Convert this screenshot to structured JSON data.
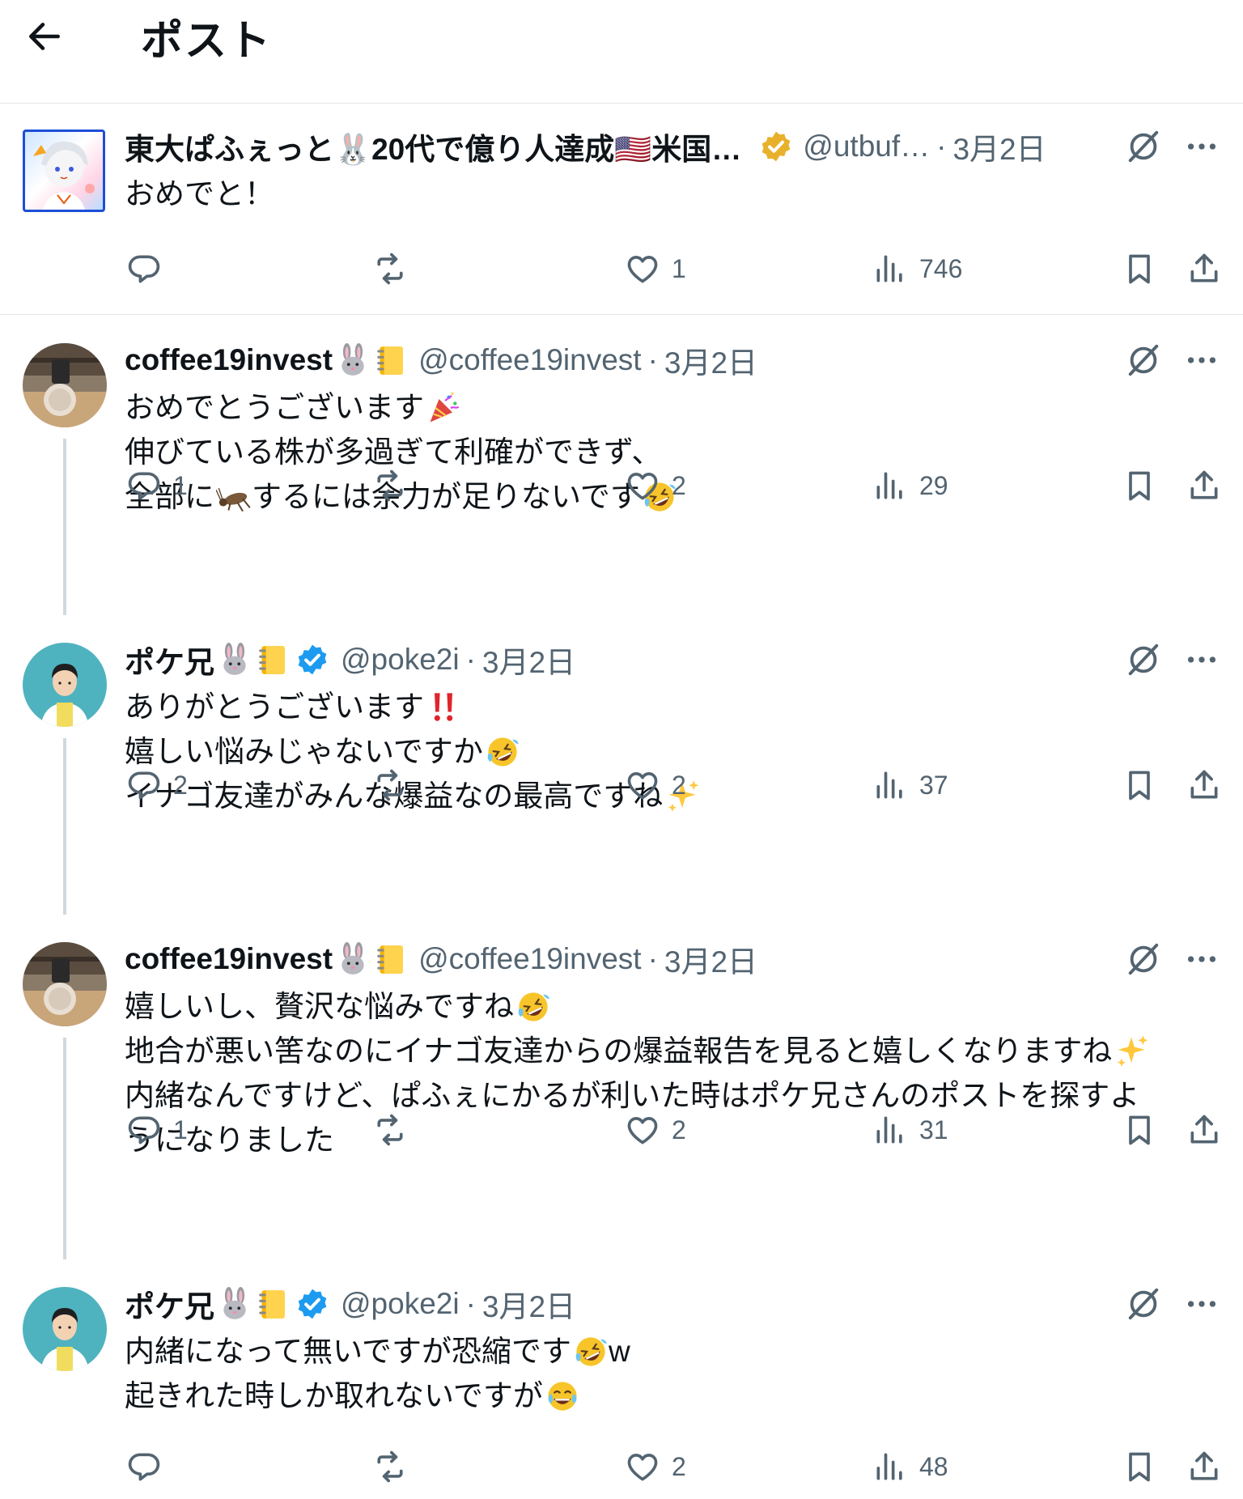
{
  "header": {
    "title": "ポスト"
  },
  "posts": [
    {
      "name": "東大ぱふぇっと🐰20代で億り人達成🇺🇸米国…",
      "handle": "@utbuf…",
      "date": "3月2日",
      "lines": [
        "おめでと！"
      ],
      "counts": {
        "reply": "",
        "repost": "",
        "like": "1",
        "views": "746"
      }
    },
    {
      "name": "coffee19invest",
      "handle": "@coffee19invest",
      "date": "3月2日",
      "lines": [
        "おめでとうございます",
        "伸びている株が多過ぎて利確ができず、",
        "全部に",
        "するには余力が足りないです"
      ],
      "counts": {
        "reply": "1",
        "repost": "",
        "like": "2",
        "views": "29"
      }
    },
    {
      "name": "ポケ兄",
      "handle": "@poke2i",
      "date": "3月2日",
      "lines": [
        "ありがとうございます",
        "嬉しい悩みじゃないですか",
        "イナゴ友達がみんな爆益なの最高ですね"
      ],
      "counts": {
        "reply": "2",
        "repost": "",
        "like": "2",
        "views": "37"
      }
    },
    {
      "name": "coffee19invest",
      "handle": "@coffee19invest",
      "date": "3月2日",
      "lines": [
        "嬉しいし、贅沢な悩みですね",
        "地合が悪い筈なのにイナゴ友達からの爆益報告を見ると嬉しくなりますね",
        "内緒なんですけど、ぱふぇにかるが利いた時はポケ兄さんのポストを探すよ",
        "うになりました"
      ],
      "counts": {
        "reply": "1",
        "repost": "",
        "like": "2",
        "views": "31"
      }
    },
    {
      "name": "ポケ兄",
      "handle": "@poke2i",
      "date": "3月2日",
      "lines": [
        "内緒になって無いですが恐縮です",
        "w",
        "起きれた時しか取れないですが"
      ],
      "counts": {
        "reply": "",
        "repost": "",
        "like": "2",
        "views": "48"
      }
    }
  ],
  "icons": {
    "back": "arrow-left-icon",
    "grok": "grok-icon",
    "more": "more-icon",
    "reply": "reply-icon",
    "repost": "repost-icon",
    "like": "heart-icon",
    "views": "views-icon",
    "bookmark": "bookmark-icon",
    "share": "share-icon",
    "verified_gold": "verified-gold-icon",
    "verified_blue": "verified-blue-icon"
  },
  "colors": {
    "text": "#0f1419",
    "secondary": "#536471",
    "gold": "#e8b12b",
    "blue": "#1d9bf0",
    "thread": "#cfd9de"
  }
}
